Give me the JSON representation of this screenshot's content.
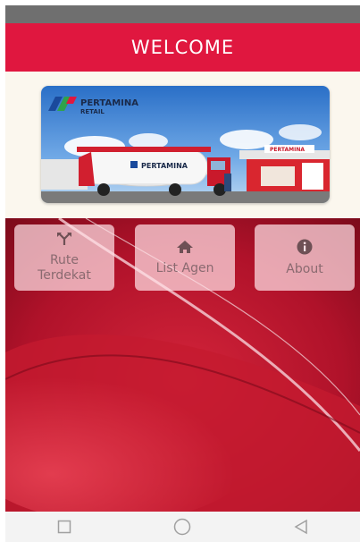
{
  "app": {
    "title": "WELCOME"
  },
  "banner": {
    "brand_name": "PERTAMINA",
    "brand_sub": "RETAIL",
    "truck_text": "PERTAMINA",
    "station_text": "PERTAMINA"
  },
  "menu": {
    "items": [
      {
        "label_line1": "Rute",
        "label_line2": "Terdekat",
        "icon": "route-icon"
      },
      {
        "label": "List Agen",
        "icon": "home-icon"
      },
      {
        "label": "About",
        "icon": "info-icon"
      }
    ]
  },
  "navbar": {
    "items": [
      "recent-apps-icon",
      "home-circle-icon",
      "back-icon"
    ]
  },
  "colors": {
    "header": "#e0173f",
    "status_bar": "#6f6f6f",
    "banner_bg": "#fbf7ee",
    "button_bg": "#ffe1e6",
    "button_text": "#8a6a70",
    "nav_bar": "#f3f3f3"
  }
}
